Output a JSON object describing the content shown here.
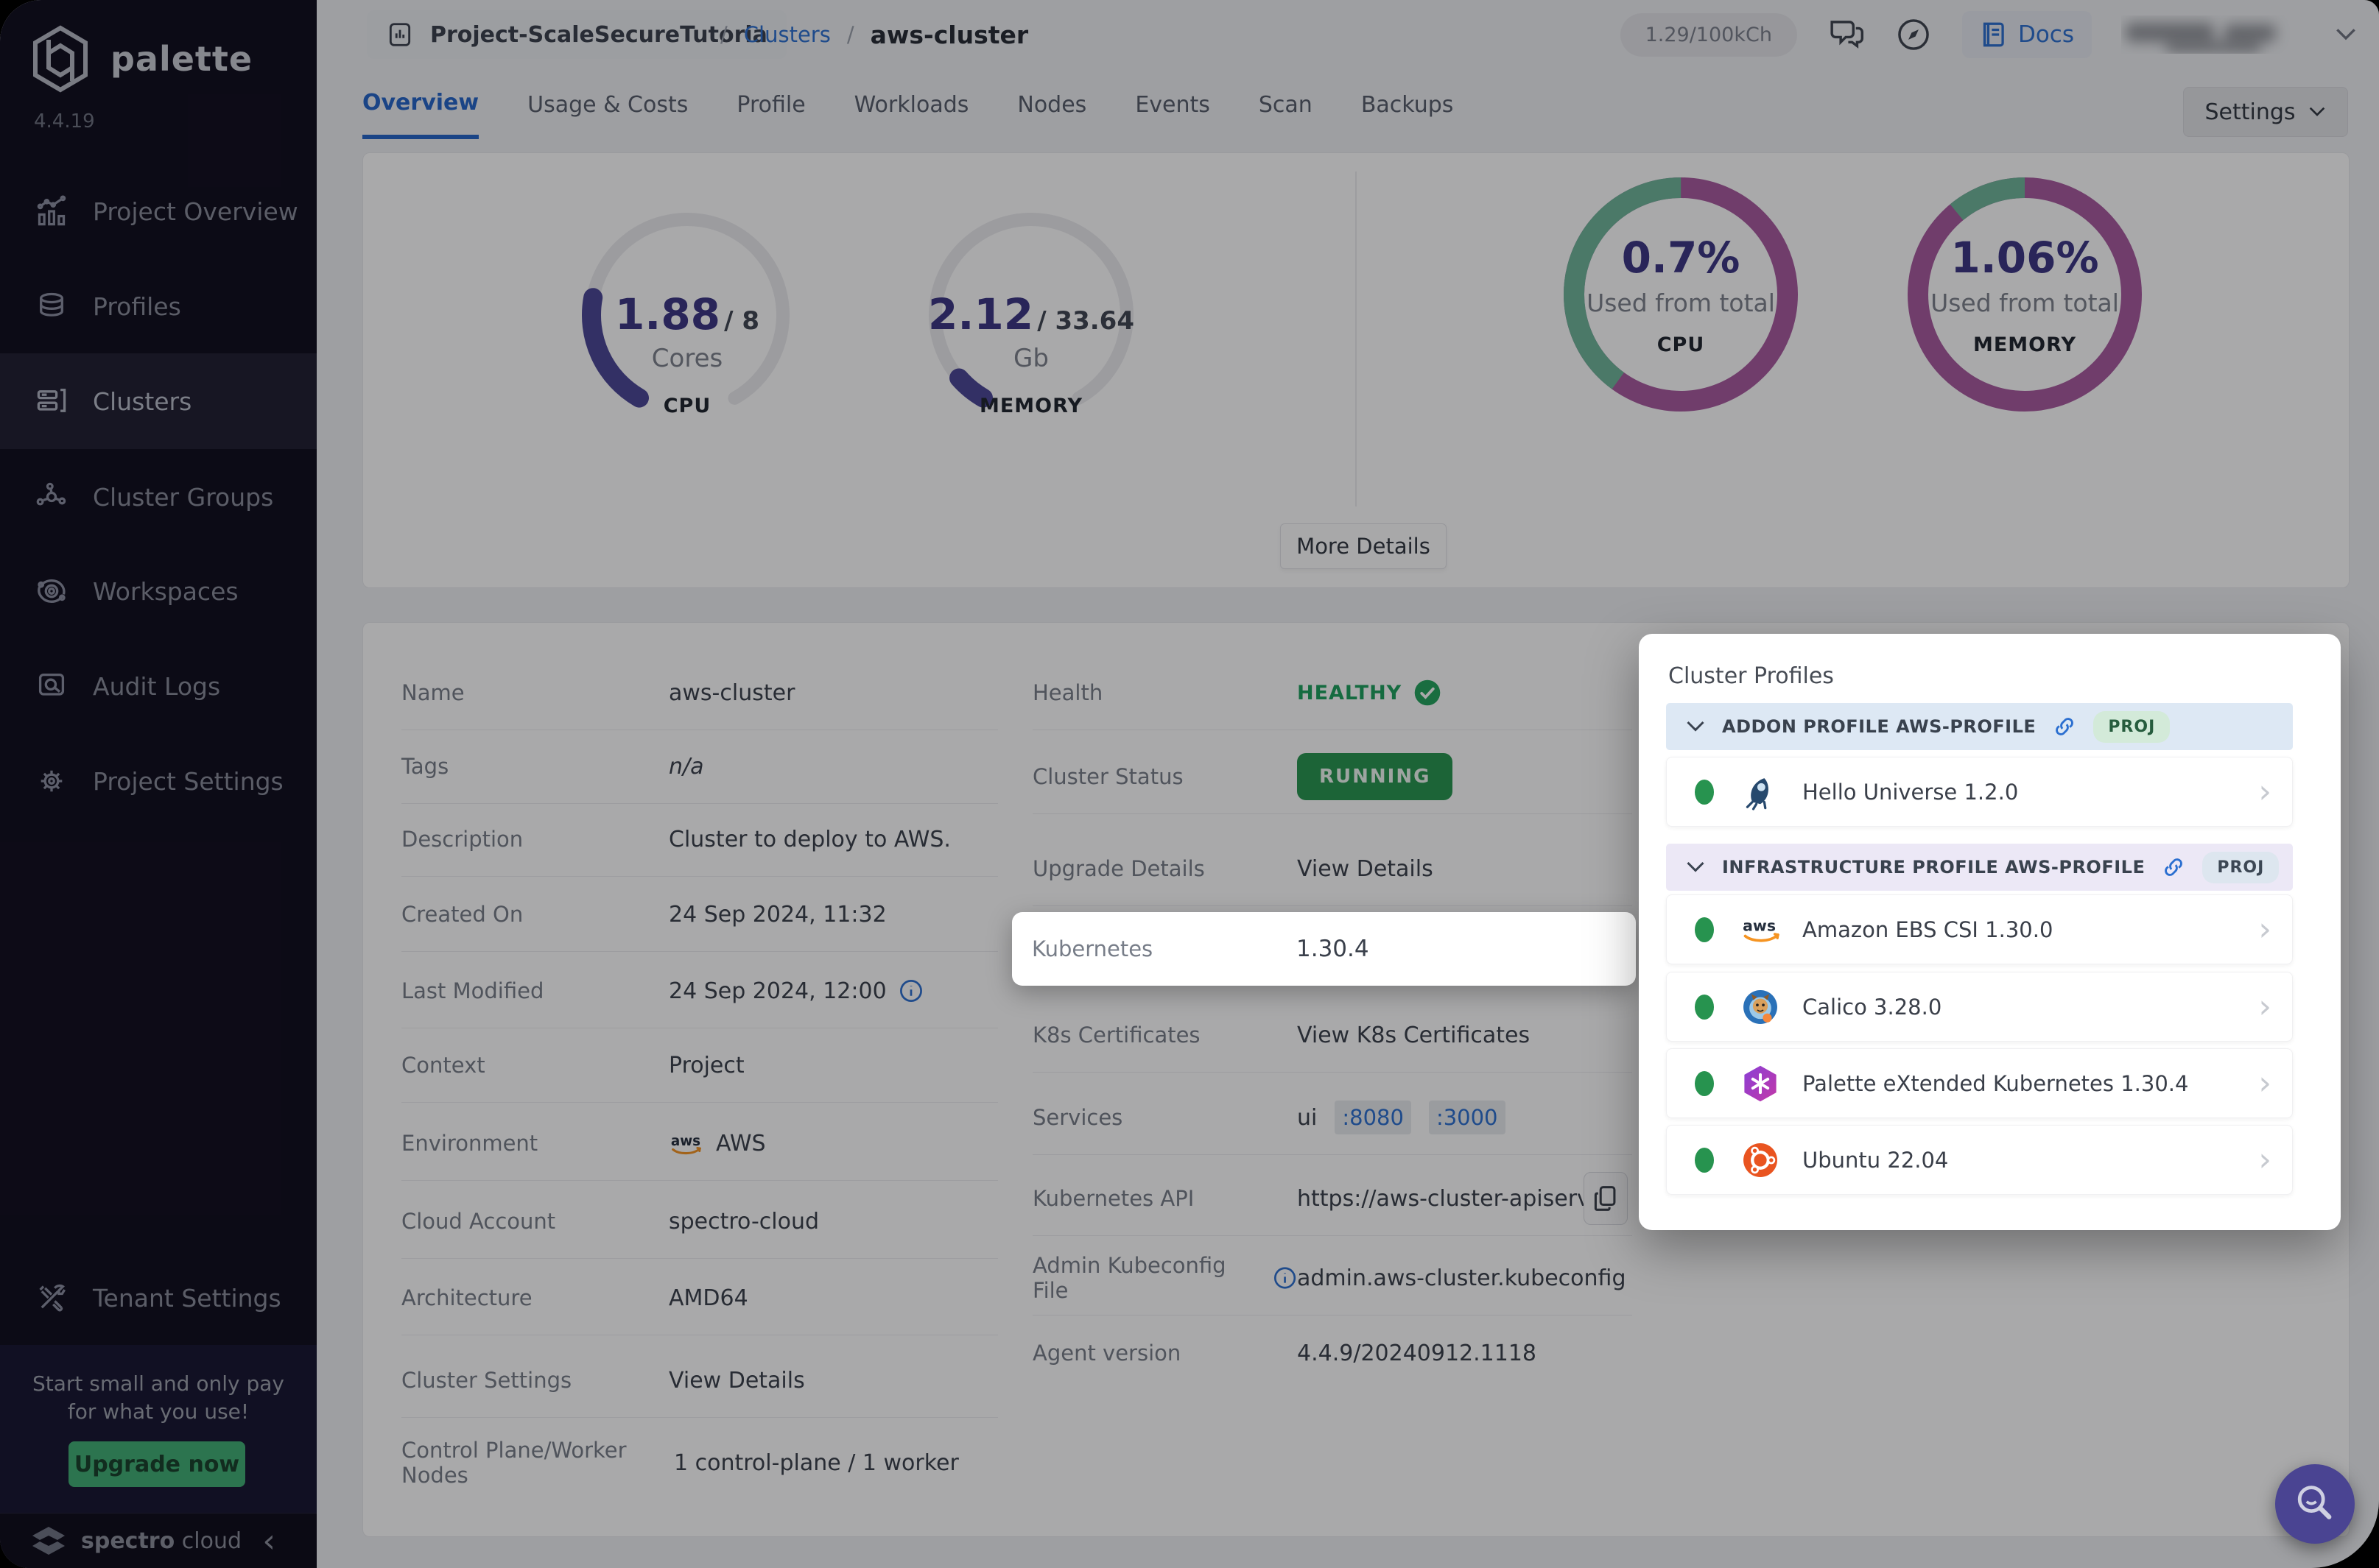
{
  "sidebar": {
    "logo_text": "palette",
    "version": "4.4.19",
    "items": [
      {
        "label": "Project Overview"
      },
      {
        "label": "Profiles"
      },
      {
        "label": "Clusters"
      },
      {
        "label": "Cluster Groups"
      },
      {
        "label": "Workspaces"
      },
      {
        "label": "Audit Logs"
      },
      {
        "label": "Project Settings"
      },
      {
        "label": "Tenant Settings"
      }
    ],
    "promo": {
      "line1": "Start small and only pay",
      "line2": "for what you use!",
      "button": "Upgrade now"
    },
    "footer": {
      "brand_bold": "spectro",
      "brand_light": " cloud"
    }
  },
  "header": {
    "project_chip": "Project-ScaleSecureTutoria",
    "sep": "/",
    "breadcrumb_section": "Clusters",
    "breadcrumb_current": "aws-cluster",
    "usage_pill": "1.29/100kCh",
    "docs_label": "Docs"
  },
  "tabs": {
    "items": [
      "Overview",
      "Usage & Costs",
      "Profile",
      "Workloads",
      "Nodes",
      "Events",
      "Scan",
      "Backups"
    ],
    "active": "Overview",
    "settings_button": "Settings"
  },
  "usage": {
    "cpu_gauge": {
      "used": "1.88",
      "total": "/ 8",
      "unit": "Cores",
      "caption": "CPU",
      "fraction": 0.235
    },
    "memory_gauge": {
      "used": "2.12",
      "total": "/ 33.64",
      "unit": "Gb",
      "caption": "MEMORY",
      "fraction": 0.063
    },
    "cpu_donut": {
      "percent": "0.7%",
      "label": "Used from total",
      "caption": "CPU",
      "green_fraction": 0.4
    },
    "memory_donut": {
      "percent": "1.06%",
      "label": "Used from total",
      "caption": "MEMORY",
      "green_fraction": 0.11
    },
    "more_details": "More Details",
    "colors": {
      "gauge": "#4b4596",
      "track": "#ebebee",
      "green": "#6fb69a",
      "magenta": "#a85a9e"
    }
  },
  "details": {
    "left": [
      {
        "label": "Name",
        "value": "aws-cluster"
      },
      {
        "label": "Tags",
        "value": "n/a"
      },
      {
        "label": "Description",
        "value": "Cluster to deploy to AWS."
      },
      {
        "label": "Created On",
        "value": "24 Sep 2024, 11:32"
      },
      {
        "label": "Last Modified",
        "value": "24 Sep 2024, 12:00"
      },
      {
        "label": "Context",
        "value": "Project"
      },
      {
        "label": "Environment",
        "value": "AWS"
      },
      {
        "label": "Cloud Account",
        "value": "spectro-cloud"
      },
      {
        "label": "Architecture",
        "value": "AMD64"
      },
      {
        "label": "Cluster Settings",
        "value": "View Details"
      },
      {
        "label": "Control Plane/Worker Nodes",
        "value": "1 control-plane / 1 worker"
      }
    ],
    "right": {
      "health_label": "Health",
      "health_value": "HEALTHY",
      "status_label": "Cluster Status",
      "status_value": "RUNNING",
      "upgrade_label": "Upgrade Details",
      "upgrade_value": "View Details",
      "kubernetes_label": "Kubernetes",
      "kubernetes_value": "1.30.4",
      "certs_label": "K8s Certificates",
      "certs_value": "View K8s Certificates",
      "services_label": "Services",
      "services_prefix": "ui",
      "services_ports": [
        ":8080",
        ":3000"
      ],
      "api_label": "Kubernetes API",
      "api_value": "https://aws-cluster-apiserve...",
      "kubeconfig_label": "Admin Kubeconfig File",
      "kubeconfig_value": "admin.aws-cluster.kubeconfig",
      "agent_label": "Agent version",
      "agent_value": "4.4.9/20240912.1118"
    }
  },
  "profiles_panel": {
    "title": "Cluster Profiles",
    "groups": [
      {
        "name": "ADDON PROFILE AWS-PROFILE",
        "badge": "PROJ",
        "items": [
          {
            "name": "Hello Universe 1.2.0",
            "icon": "hello-universe"
          }
        ]
      },
      {
        "name": "INFRASTRUCTURE PROFILE AWS-PROFILE",
        "badge": "PROJ",
        "items": [
          {
            "name": "Amazon EBS CSI 1.30.0",
            "icon": "aws"
          },
          {
            "name": "Calico 3.28.0",
            "icon": "calico"
          },
          {
            "name": "Palette eXtended Kubernetes 1.30.4",
            "icon": "palette-pxk"
          },
          {
            "name": "Ubuntu 22.04",
            "icon": "ubuntu"
          }
        ]
      }
    ]
  }
}
